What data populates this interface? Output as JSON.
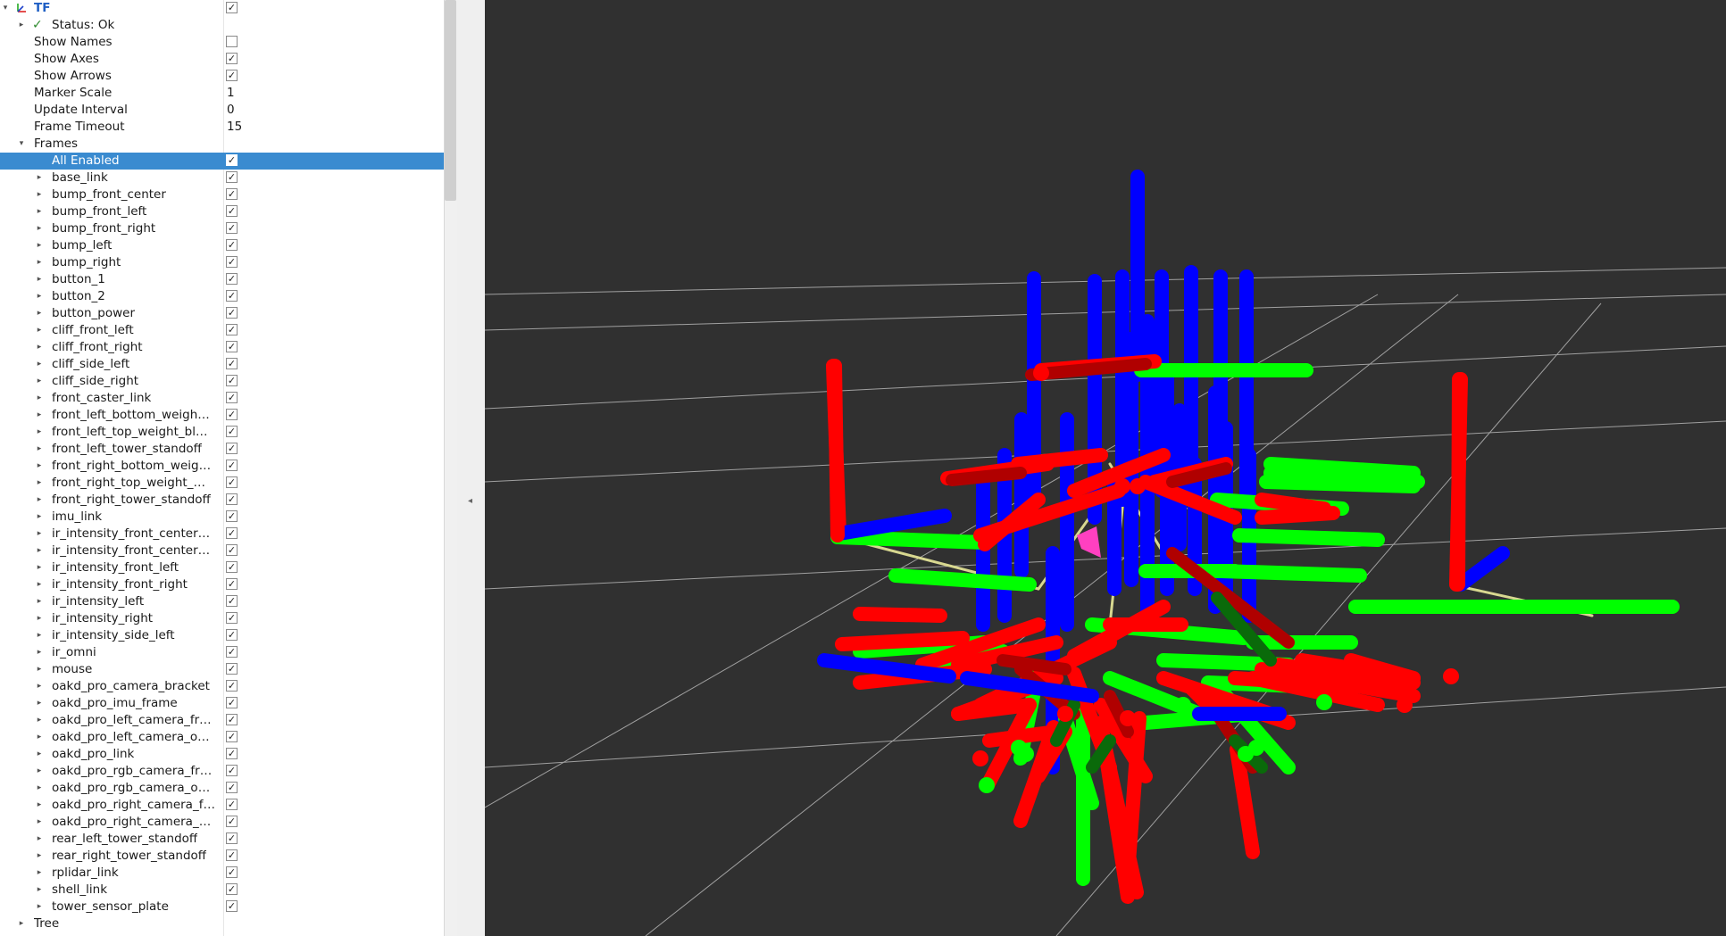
{
  "display": {
    "name": "TF",
    "status": "Status: Ok",
    "properties": [
      {
        "label": "Show Names",
        "type": "checkbox",
        "checked": false
      },
      {
        "label": "Show Axes",
        "type": "checkbox",
        "checked": true
      },
      {
        "label": "Show Arrows",
        "type": "checkbox",
        "checked": true
      },
      {
        "label": "Marker Scale",
        "type": "text",
        "value": "1"
      },
      {
        "label": "Update Interval",
        "type": "text",
        "value": "0"
      },
      {
        "label": "Frame Timeout",
        "type": "text",
        "value": "15"
      }
    ],
    "frames_label": "Frames",
    "all_enabled_label": "All Enabled",
    "frames": [
      "base_link",
      "bump_front_center",
      "bump_front_left",
      "bump_front_right",
      "bump_left",
      "bump_right",
      "button_1",
      "button_2",
      "button_power",
      "cliff_front_left",
      "cliff_front_right",
      "cliff_side_left",
      "cliff_side_right",
      "front_caster_link",
      "front_left_bottom_weigh…",
      "front_left_top_weight_bl…",
      "front_left_tower_standoff",
      "front_right_bottom_weig…",
      "front_right_top_weight_…",
      "front_right_tower_standoff",
      "imu_link",
      "ir_intensity_front_center…",
      "ir_intensity_front_center…",
      "ir_intensity_front_left",
      "ir_intensity_front_right",
      "ir_intensity_left",
      "ir_intensity_right",
      "ir_intensity_side_left",
      "ir_omni",
      "mouse",
      "oakd_pro_camera_bracket",
      "oakd_pro_imu_frame",
      "oakd_pro_left_camera_fr…",
      "oakd_pro_left_camera_o…",
      "oakd_pro_link",
      "oakd_pro_rgb_camera_fr…",
      "oakd_pro_rgb_camera_o…",
      "oakd_pro_right_camera_f…",
      "oakd_pro_right_camera_…",
      "rear_left_tower_standoff",
      "rear_right_tower_standoff",
      "rplidar_link",
      "shell_link",
      "tower_sensor_plate"
    ],
    "tree_label": "Tree"
  },
  "colors": {
    "x_axis": "#ff0000",
    "y_axis": "#00ff00",
    "z_axis": "#0000ff",
    "selection": "#3a8bd0",
    "viewport_bg": "#303030",
    "grid": "#a0a0a0"
  },
  "icons": {
    "tf": "tf-axes-icon",
    "status": "checkmark-icon",
    "expander": "triangle-expander-icon"
  }
}
